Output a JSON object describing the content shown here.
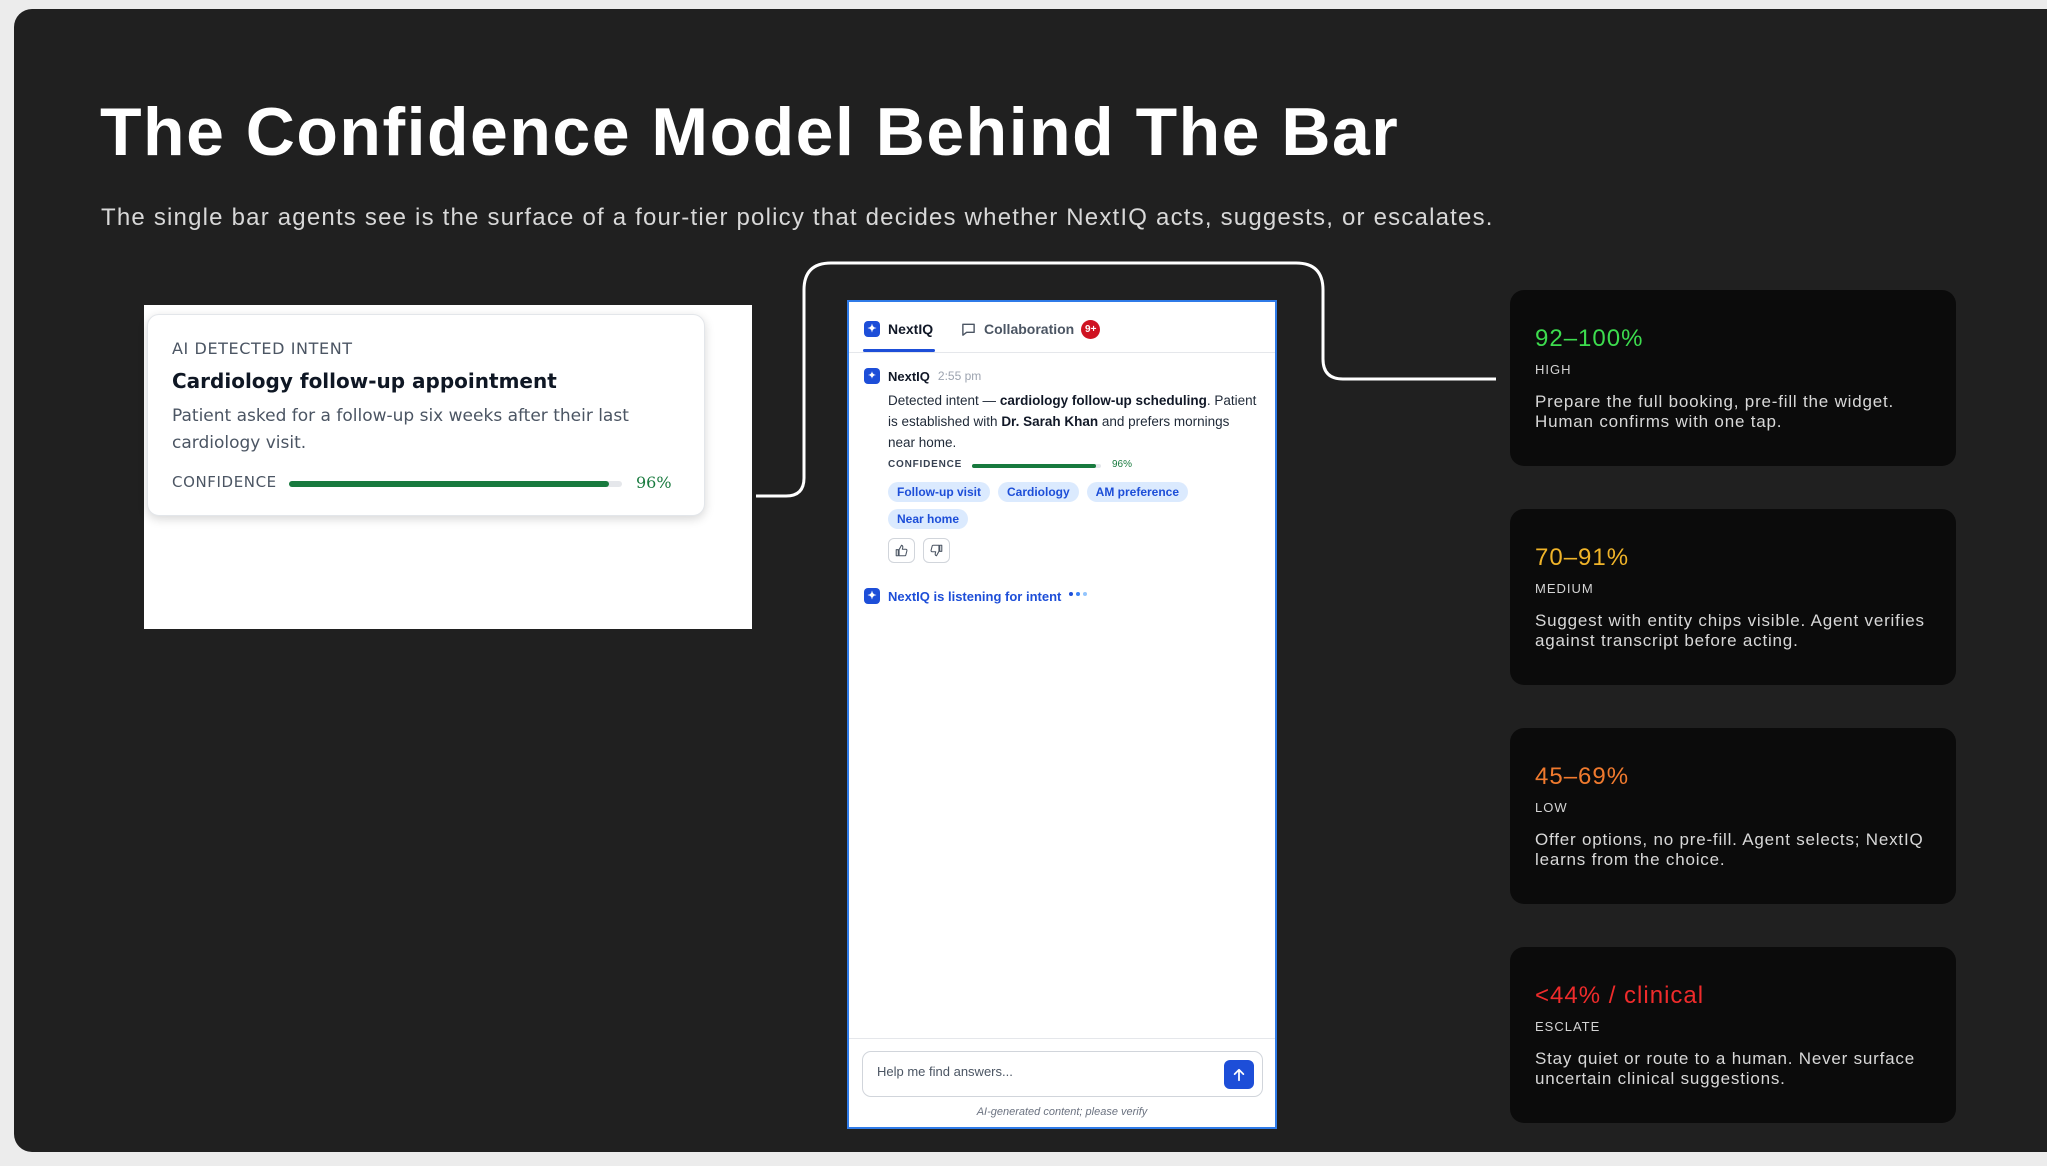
{
  "title": "The Confidence Model Behind The Bar",
  "subtitle": "The single bar agents see is the surface of a four-tier policy that decides whether NextIQ acts, suggests, or escalates.",
  "intent_card": {
    "label": "AI DETECTED INTENT",
    "title": "Cardiology follow-up appointment",
    "description": "Patient asked for a follow-up six weeks after their last cardiology visit.",
    "confidence_label": "CONFIDENCE",
    "confidence_value": "96%",
    "confidence_fraction": 0.96
  },
  "assistant": {
    "tabs": [
      {
        "label": "NextIQ",
        "icon": "nextiq-icon",
        "active": true
      },
      {
        "label": "Collaboration",
        "icon": "chat-bubble-icon",
        "badge": "9+"
      }
    ],
    "message": {
      "sender": "NextIQ",
      "time": "2:55 pm",
      "text_1": "Detected intent — ",
      "intent_bold": "cardiology follow-up scheduling",
      "text_2": ". Patient is established with ",
      "doctor_bold": "Dr. Sarah Khan",
      "text_3": " and prefers mornings near home.",
      "confidence_label": "CONFIDENCE",
      "confidence_value": "96%",
      "confidence_fraction": 0.96,
      "chips": [
        "Follow-up visit",
        "Cardiology",
        "AM preference",
        "Near home"
      ],
      "feedback": {
        "up": "thumbs-up-icon",
        "down": "thumbs-down-icon"
      }
    },
    "listening_text": "NextIQ is listening for intent",
    "input_placeholder": "Help me find answers...",
    "send_icon": "arrow-up-icon",
    "disclaimer": "AI-generated content; please verify"
  },
  "tiers": [
    {
      "range": "92–100%",
      "level": "HIGH",
      "description": "Prepare the full booking, pre-fill the widget. Human confirms with one tap.",
      "color": "#3ddc4e"
    },
    {
      "range": "70–91%",
      "level": "MEDIUM",
      "description": "Suggest with entity chips visible. Agent verifies against transcript before acting.",
      "color": "#f0b429"
    },
    {
      "range": "45–69%",
      "level": "LOW",
      "description": "Offer options, no pre-fill. Agent selects; NextIQ learns from the choice.",
      "color": "#f07a2e"
    },
    {
      "range": "<44% / clinical",
      "level": "ESCLATE",
      "description": "Stay quiet or route to a human. Never surface uncertain clinical suggestions.",
      "color": "#ef2b2b"
    }
  ],
  "colors": {
    "background": "#202020",
    "accent": "#1d4ed8",
    "confidence": "#187a3e",
    "phone_border": "#2f7be8"
  }
}
